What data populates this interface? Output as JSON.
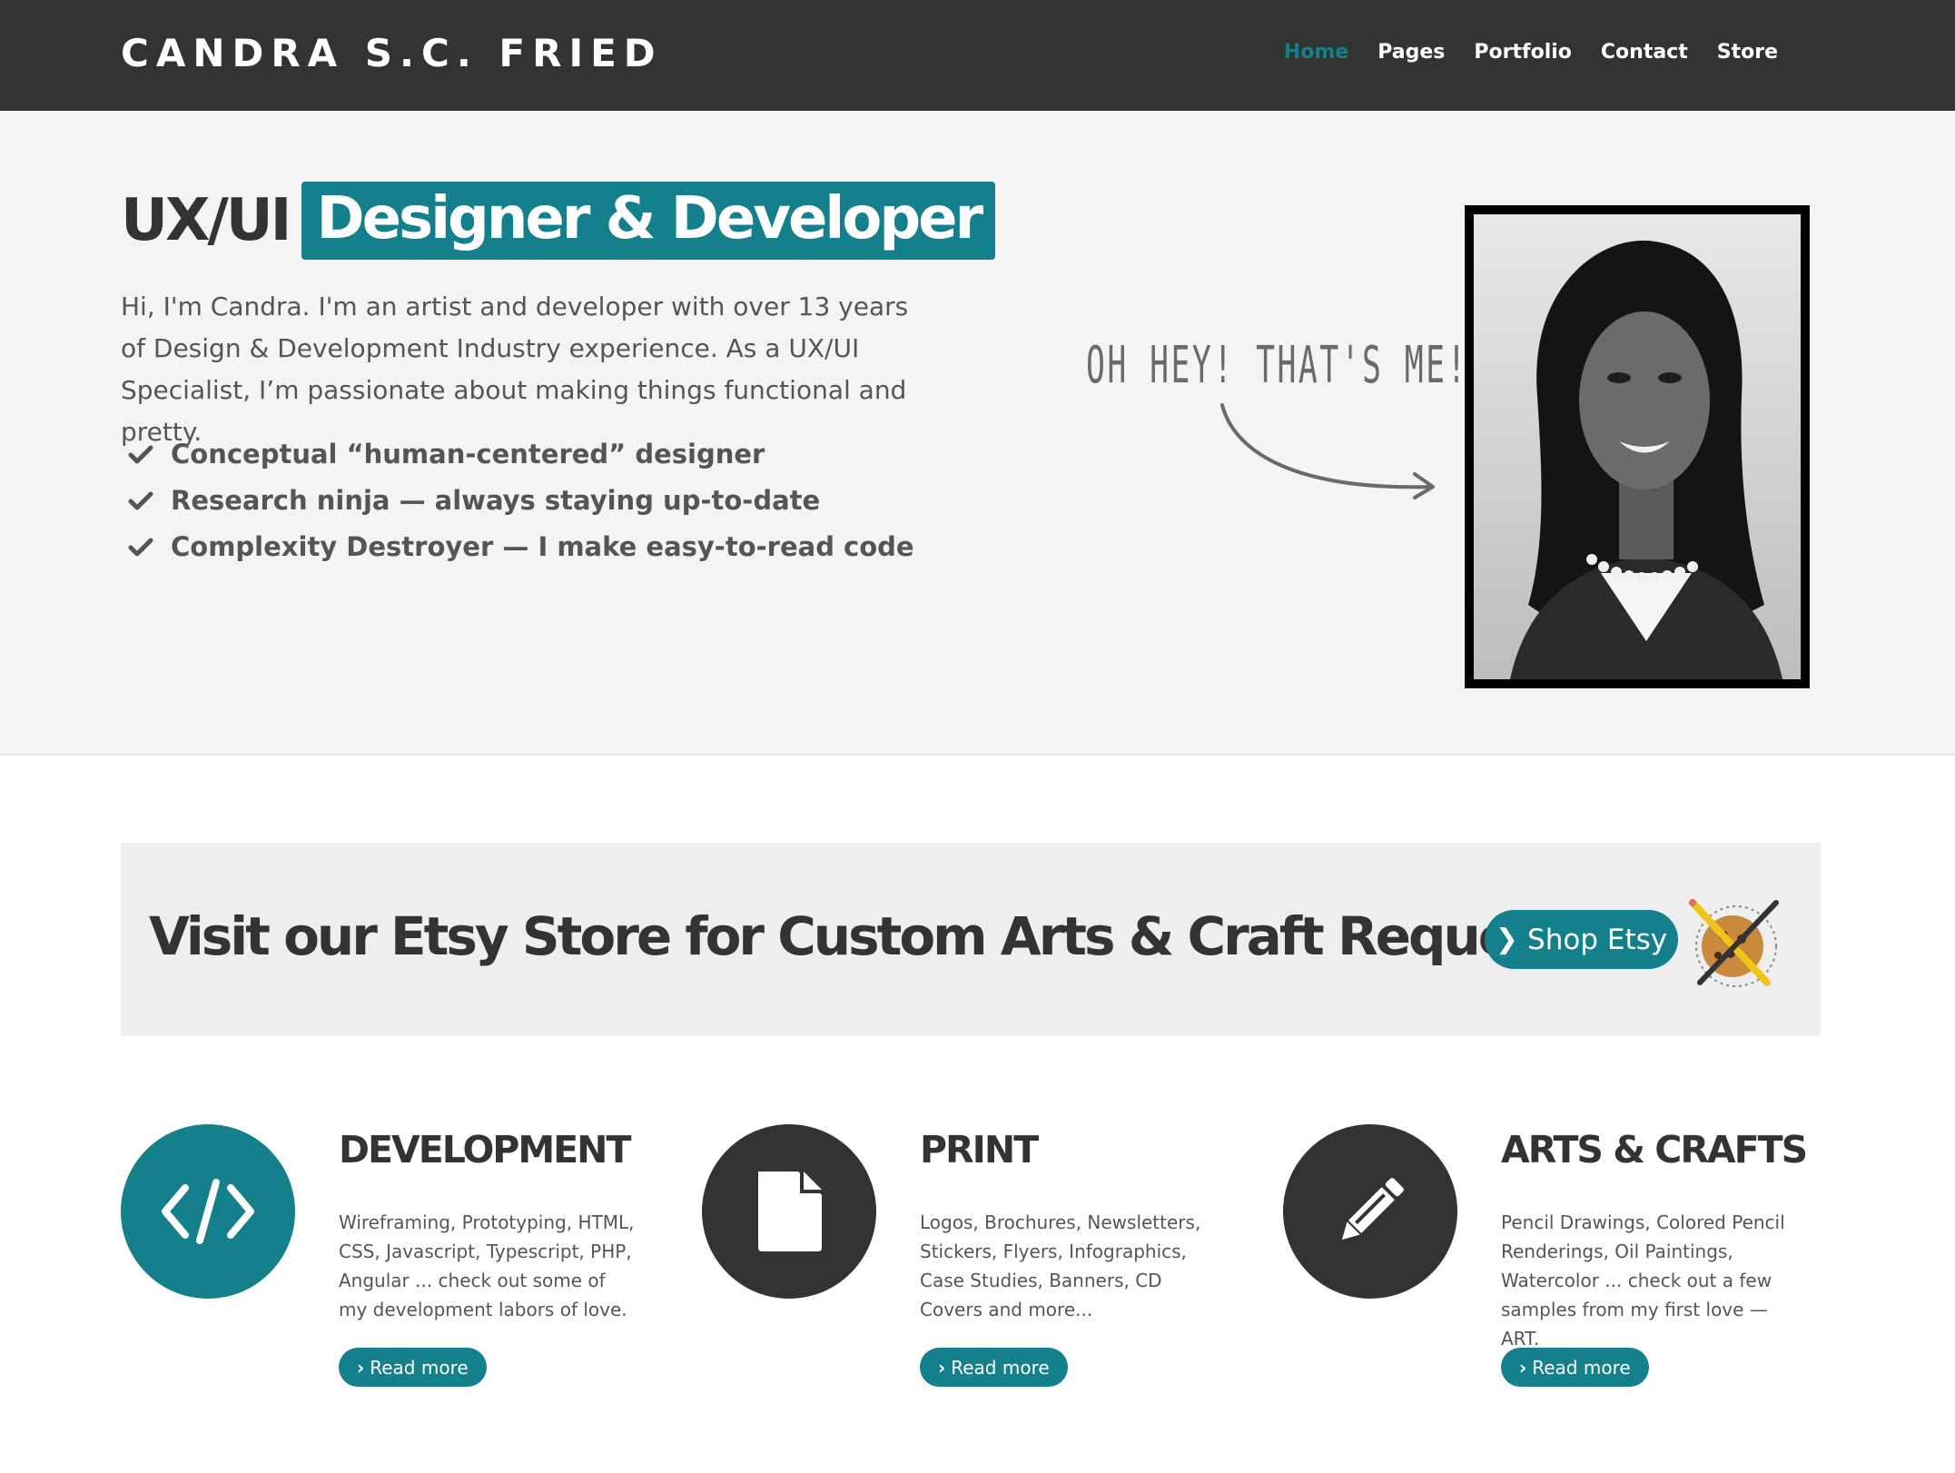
{
  "header": {
    "brand": "CANDRA S.C. FRIED",
    "nav": [
      {
        "label": "Home",
        "active": true
      },
      {
        "label": "Pages",
        "active": false
      },
      {
        "label": "Portfolio",
        "active": false
      },
      {
        "label": "Contact",
        "active": false
      },
      {
        "label": "Store",
        "active": false
      }
    ]
  },
  "hero": {
    "headline_plain": "UX/UI",
    "headline_highlight": "Designer & Developer",
    "intro": "Hi, I'm Candra. I'm an artist and developer with over 13 years of Design & Development Industry experience. As a UX/UI Specialist, I’m passionate about making things functional and pretty.",
    "checks": [
      "Conceptual “human-centered” designer",
      "Research ninja — always staying up-to-date",
      "Complexity Destroyer — I make easy-to-read code"
    ],
    "handwritten_note": "OH HEY! THAT'S ME!"
  },
  "etsy": {
    "title": "Visit our Etsy Store for Custom Arts & Craft Requests",
    "button_label": "Shop Etsy",
    "button_icon": "chevron-right-icon"
  },
  "services": [
    {
      "title": "DEVELOPMENT",
      "icon": "code-icon",
      "color": "#13808c",
      "desc": "Wireframing, Prototyping, HTML, CSS, Javascript, Typescript, PHP, Angular ... check out some of my development labors of love.",
      "button": "Read more"
    },
    {
      "title": "PRINT",
      "icon": "document-icon",
      "color": "#333333",
      "desc": "Logos, Brochures, Newsletters, Stickers, Flyers, Infographics, Case Studies, Banners, CD Covers and more...",
      "button": "Read more"
    },
    {
      "title": "ARTS & CRAFTS",
      "icon": "pencil-icon",
      "color": "#333333",
      "desc": "Pencil Drawings, Colored Pencil Renderings, Oil Paintings, Watercolor ... check out a few samples from my first love — ART.",
      "button": "Read more"
    }
  ],
  "colors": {
    "accent": "#13808c",
    "header_bg": "#333333",
    "hero_bg": "#f4f4f4",
    "banner_bg": "#eeeeee"
  }
}
